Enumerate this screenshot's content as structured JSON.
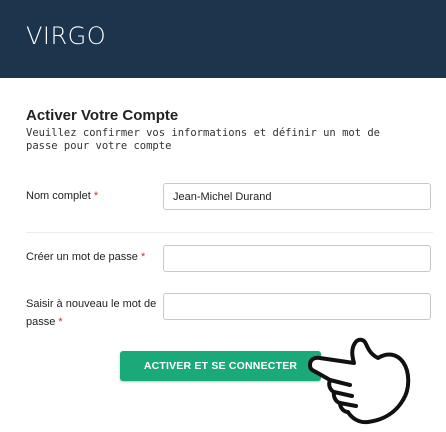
{
  "header": {
    "logo": "VIRGO",
    "background": "#1c354d"
  },
  "form": {
    "title": "Activer Votre Compte",
    "subtitle": "Veuillez confirmer vos informations et définir un mot de passe pour votre compte",
    "required_marker": "*",
    "fields": [
      {
        "label": "Nom complet",
        "value": "Jean-Michel Durand"
      },
      {
        "label": "Créer un mot de passe",
        "value": ""
      },
      {
        "label": "Saisir à nouveau le mot de passe",
        "value": ""
      }
    ],
    "submit_label": "ACTIVER ET SE CONNECTER",
    "accent": "#1aa978"
  },
  "cursor": {
    "icon": "pointing-hand-icon"
  }
}
